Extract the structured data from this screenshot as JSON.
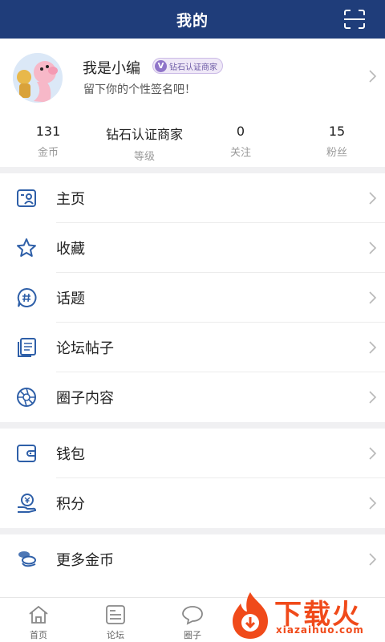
{
  "header": {
    "title": "我的"
  },
  "profile": {
    "nickname": "我是小编",
    "badge_v": "V",
    "badge": "钻石认证商家",
    "signature": "留下你的个性签名吧！"
  },
  "stats": [
    {
      "value": "131",
      "label": "金币"
    },
    {
      "value": "钻石认证商家",
      "label": "等级"
    },
    {
      "value": "0",
      "label": "关注"
    },
    {
      "value": "15",
      "label": "粉丝"
    }
  ],
  "menu_group_1": [
    {
      "label": "主页",
      "icon": "homepage-card-icon"
    },
    {
      "label": "收藏",
      "icon": "star-icon"
    },
    {
      "label": "话题",
      "icon": "hashtag-icon"
    },
    {
      "label": "论坛帖子",
      "icon": "document-icon"
    },
    {
      "label": "圈子内容",
      "icon": "aperture-icon"
    }
  ],
  "menu_group_2": [
    {
      "label": "钱包",
      "icon": "wallet-icon"
    },
    {
      "label": "积分",
      "icon": "points-icon"
    }
  ],
  "menu_group_3": [
    {
      "label": "更多金币",
      "icon": "coins-icon"
    }
  ],
  "tabbar": [
    {
      "label": "首页",
      "icon": "home-icon"
    },
    {
      "label": "论坛",
      "icon": "forum-icon"
    },
    {
      "label": "圈子",
      "icon": "chat-bubble-icon"
    }
  ],
  "watermark": {
    "main": "下载火",
    "sub": "xiazaihuo.com"
  },
  "colors": {
    "header_bg": "#1f3d7a",
    "icon_blue": "#2e5fa8",
    "watermark": "#f04a1a"
  }
}
